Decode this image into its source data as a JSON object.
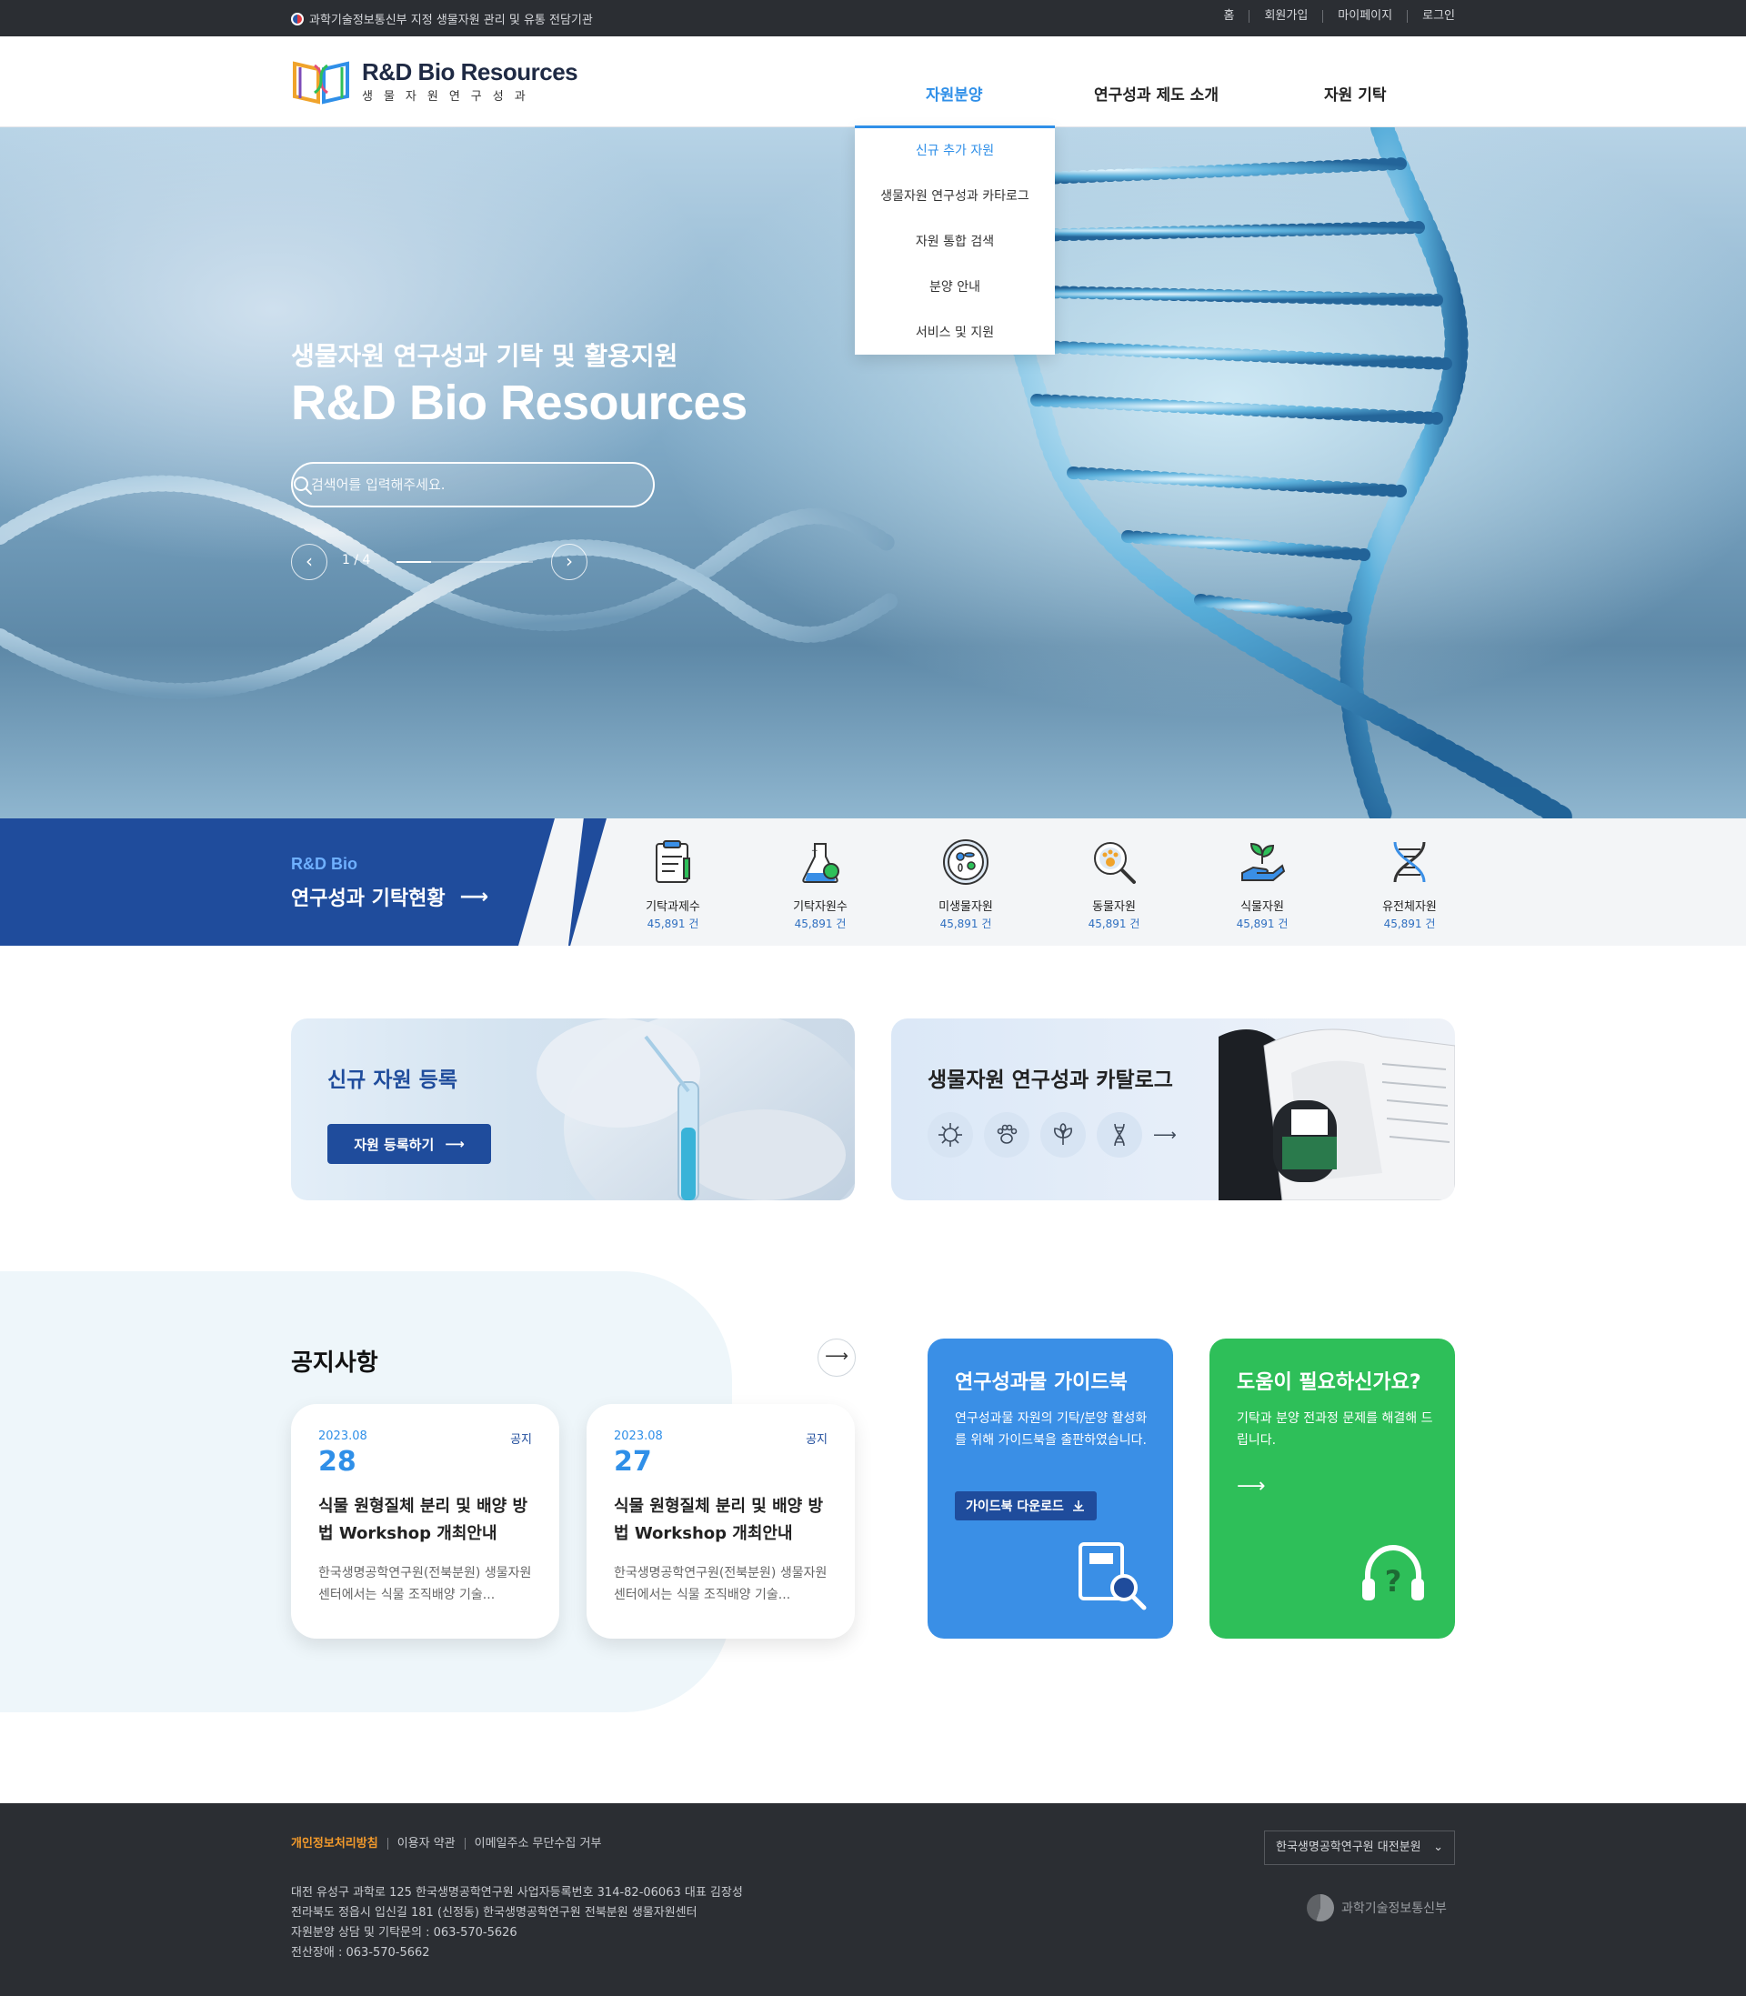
{
  "topbar": {
    "notice": "과학기술정보통신부 지정 생물자원 관리 및 유통 전담기관",
    "links": [
      "홈",
      "회원가입",
      "마이페이지",
      "로그인"
    ]
  },
  "header": {
    "logo_title": "R&D Bio Resources",
    "logo_sub": "생물자원연구성과",
    "nav": [
      "자원분양",
      "연구성과 제도 소개",
      "자원 기탁"
    ]
  },
  "dropdown": {
    "items": [
      "신규 추가 자원",
      "생물자원 연구성과 카타로그",
      "자원 통합 검색",
      "분양 안내",
      "서비스 및 지원"
    ]
  },
  "hero": {
    "subtitle": "생물자원 연구성과 기탁 및 활용지원",
    "title": "R&D Bio Resources",
    "search_placeholder": "검색어를 입력해주세요.",
    "pager": "1 / 4",
    "progress": 0.25
  },
  "stats": {
    "small": "R&D Bio",
    "title": "연구성과 기탁현황",
    "items": [
      {
        "label": "기탁과제수",
        "value": "45,891 건",
        "icon": "clipboard-icon"
      },
      {
        "label": "기탁자원수",
        "value": "45,891 건",
        "icon": "flask-icon"
      },
      {
        "label": "미생물자원",
        "value": "45,891 건",
        "icon": "microbe-icon"
      },
      {
        "label": "동물자원",
        "value": "45,891 건",
        "icon": "paw-magnifier-icon"
      },
      {
        "label": "식물자원",
        "value": "45,891 건",
        "icon": "sprout-icon"
      },
      {
        "label": "유전체자원",
        "value": "45,891 건",
        "icon": "dna-icon"
      }
    ]
  },
  "banners": {
    "new": {
      "title": "신규 자원 등록",
      "button": "자원 등록하기"
    },
    "catalog": {
      "title": "생물자원 연구성과 카탈로그"
    }
  },
  "notice": {
    "title": "공지사항",
    "cards": [
      {
        "ym": "2023.08",
        "day": "28",
        "tag": "공지",
        "title": "식물 원형질체 분리 및 배양 방법 Workshop 개최안내",
        "desc": "한국생명공학연구원(전북분원) 생물자원센터에서는 식물 조직배양 기술..."
      },
      {
        "ym": "2023.08",
        "day": "27",
        "tag": "공지",
        "title": "식물 원형질체 분리 및 배양 방법 Workshop 개최안내",
        "desc": "한국생명공학연구원(전북분원) 생물자원센터에서는 식물 조직배양 기술..."
      }
    ]
  },
  "guide": {
    "title": "연구성과물 가이드북",
    "desc": "연구성과물 자원의 기탁/분양 활성화를 위해 가이드북을 출판하였습니다.",
    "button": "가이드북 다운로드"
  },
  "help": {
    "title": "도움이 필요하신가요?",
    "desc": "기탁과 분양 전과정 문제를 해결해 드립니다."
  },
  "footer": {
    "links": [
      "개인정보처리방침",
      "이용자 약관",
      "이메일주소 무단수집 거부"
    ],
    "address": [
      "대전 유성구 과학로 125 한국생명공학연구원 사업자등록번호 314-82-06063 대표 김장성",
      "전라북도 정읍시 입신길 181 (신정동) 한국생명공학연구원 전북분원 생물자원센터",
      "자원분양 상담 및 기탁문의 : 063-570-5626",
      "전산장애 : 063-570-5662"
    ],
    "family_site": "한국생명공학연구원 대전분원",
    "gov": "과학기술정보통신부"
  },
  "colors": {
    "primary": "#1f4c9c",
    "accent": "#2f8fe8",
    "guide": "#3a8fe6",
    "help": "#2ebf59",
    "footer": "#2b2e33"
  }
}
